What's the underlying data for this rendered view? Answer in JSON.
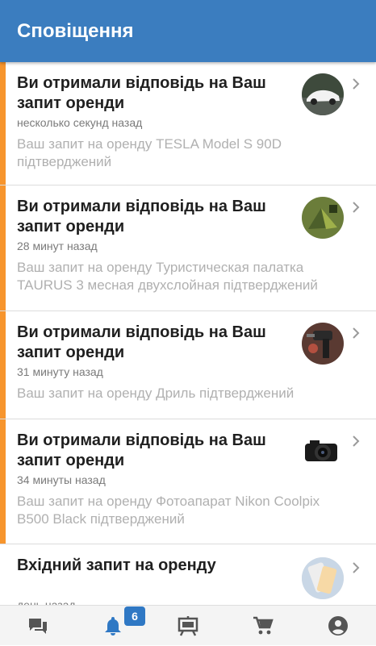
{
  "header": {
    "title": "Сповіщення"
  },
  "notifications": [
    {
      "title": "Ви отримали відповідь на Ваш запит оренди",
      "time": "несколько секунд назад",
      "text": "Ваш запит на оренду TESLA Model S 90D підтверджений",
      "image": "car-thumbnail",
      "unread": true
    },
    {
      "title": "Ви отримали відповідь на Ваш запит оренди",
      "time": "28 минут назад",
      "text": "Ваш запит на оренду Туристическая палатка TAURUS 3 месная двухслойная підтверджений",
      "image": "tent-thumbnail",
      "unread": true
    },
    {
      "title": "Ви отримали відповідь на Ваш запит оренди",
      "time": "31 минуту назад",
      "text": "Ваш запит на оренду Дриль підтверджений",
      "image": "drill-thumbnail",
      "unread": true
    },
    {
      "title": "Ви отримали відповідь на Ваш запит оренди",
      "time": "34 минуты назад",
      "text": "Ваш запит на оренду Фотоапарат Nikon Coolpix B500 Black підтверджений",
      "image": "camera-thumbnail",
      "unread": true
    },
    {
      "title": "Вхідний запит на оренду",
      "time": "день назад",
      "text": "",
      "image": "phone-thumbnail",
      "unread": false
    }
  ],
  "bottom_nav": {
    "items": [
      "chat-icon",
      "bell-icon",
      "board-icon",
      "cart-icon",
      "account-icon"
    ],
    "active": "bell-icon",
    "badge": "6"
  },
  "colors": {
    "header": "#3b7dbf",
    "unread_bar": "#f7952d",
    "active_icon": "#2f78c4",
    "inactive_icon": "#555555"
  }
}
